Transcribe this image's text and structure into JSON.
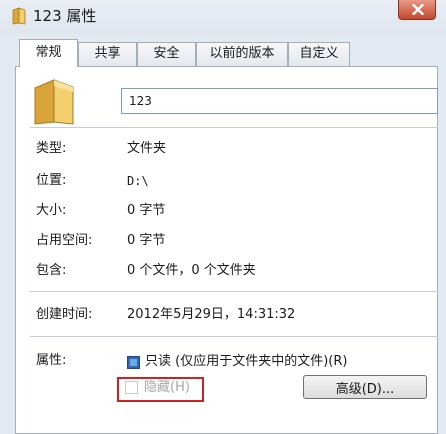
{
  "window": {
    "title": "123 属性"
  },
  "tabs": [
    {
      "label": "常规",
      "active": true
    },
    {
      "label": "共享"
    },
    {
      "label": "安全"
    },
    {
      "label": "以前的版本"
    },
    {
      "label": "自定义"
    }
  ],
  "general": {
    "name_value": "123",
    "type_label": "类型:",
    "type_value": "文件夹",
    "location_label": "位置:",
    "location_value": "D:\\",
    "size_label": "大小:",
    "size_value": "0 字节",
    "size_on_disk_label": "占用空间:",
    "size_on_disk_value": "0 字节",
    "contains_label": "包含:",
    "contains_value": "0 个文件，0 个文件夹",
    "created_label": "创建时间:",
    "created_value": "2012年5月29日，14:31:32",
    "attributes_label": "属性:",
    "readonly_label": "只读 (仅应用于文件夹中的文件)(R)",
    "hidden_label": "隐藏(H)",
    "advanced_button": "高级(D)..."
  },
  "colors": {
    "highlight_border": "#cc2222",
    "readonly_checkbox": "#2f69ad"
  }
}
